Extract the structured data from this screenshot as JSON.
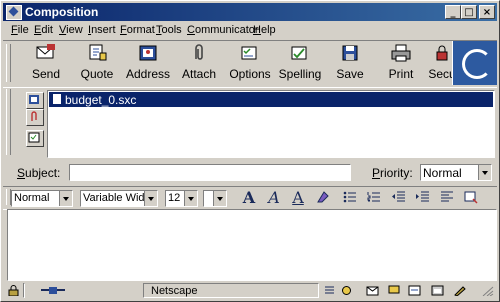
{
  "window": {
    "title": "Composition"
  },
  "title_controls": {
    "minimize": "_",
    "maximize": "□",
    "close": "×"
  },
  "menu": {
    "items": [
      {
        "label": "File",
        "mnemonic": "F",
        "rest": "ile"
      },
      {
        "label": "Edit",
        "mnemonic": "E",
        "rest": "dit"
      },
      {
        "label": "View",
        "mnemonic": "V",
        "rest": "iew"
      },
      {
        "label": "Insert",
        "mnemonic": "I",
        "rest": "nsert"
      },
      {
        "label": "Format",
        "mnemonic": "F",
        "rest": "ormat"
      },
      {
        "label": "Tools",
        "mnemonic": "T",
        "rest": "ools"
      },
      {
        "label": "Communicator",
        "mnemonic": "C",
        "rest": "ommunicator"
      },
      {
        "label": "Help",
        "mnemonic": "H",
        "rest": "elp"
      }
    ]
  },
  "toolbar": {
    "items": [
      {
        "label": "Send",
        "icon": "send-icon"
      },
      {
        "label": "Quote",
        "icon": "quote-icon"
      },
      {
        "label": "Address",
        "icon": "address-icon"
      },
      {
        "label": "Attach",
        "icon": "attach-icon"
      },
      {
        "label": "Options",
        "icon": "options-icon"
      },
      {
        "label": "Spelling",
        "icon": "spelling-icon"
      },
      {
        "label": "Save",
        "icon": "save-icon"
      },
      {
        "label": "Print",
        "icon": "print-icon"
      },
      {
        "label": "Secu",
        "icon": "security-icon"
      }
    ]
  },
  "attachments": {
    "items": [
      "budget_0.sxc"
    ]
  },
  "subject": {
    "label_mn": "S",
    "label_rest": "ubject:",
    "value": ""
  },
  "priority": {
    "label_mn": "P",
    "label_rest": "riority:",
    "value": "Normal"
  },
  "format": {
    "paragraph": "Normal",
    "font": "Variable Width",
    "size": "12",
    "color": "",
    "buttons": [
      "A",
      "A",
      "A"
    ]
  },
  "status": {
    "text": "Netscape"
  },
  "colors": {
    "title_start": "#0a246a",
    "title_end": "#3a6ea5",
    "face": "#d4d0c8",
    "selection": "#0a246a"
  }
}
